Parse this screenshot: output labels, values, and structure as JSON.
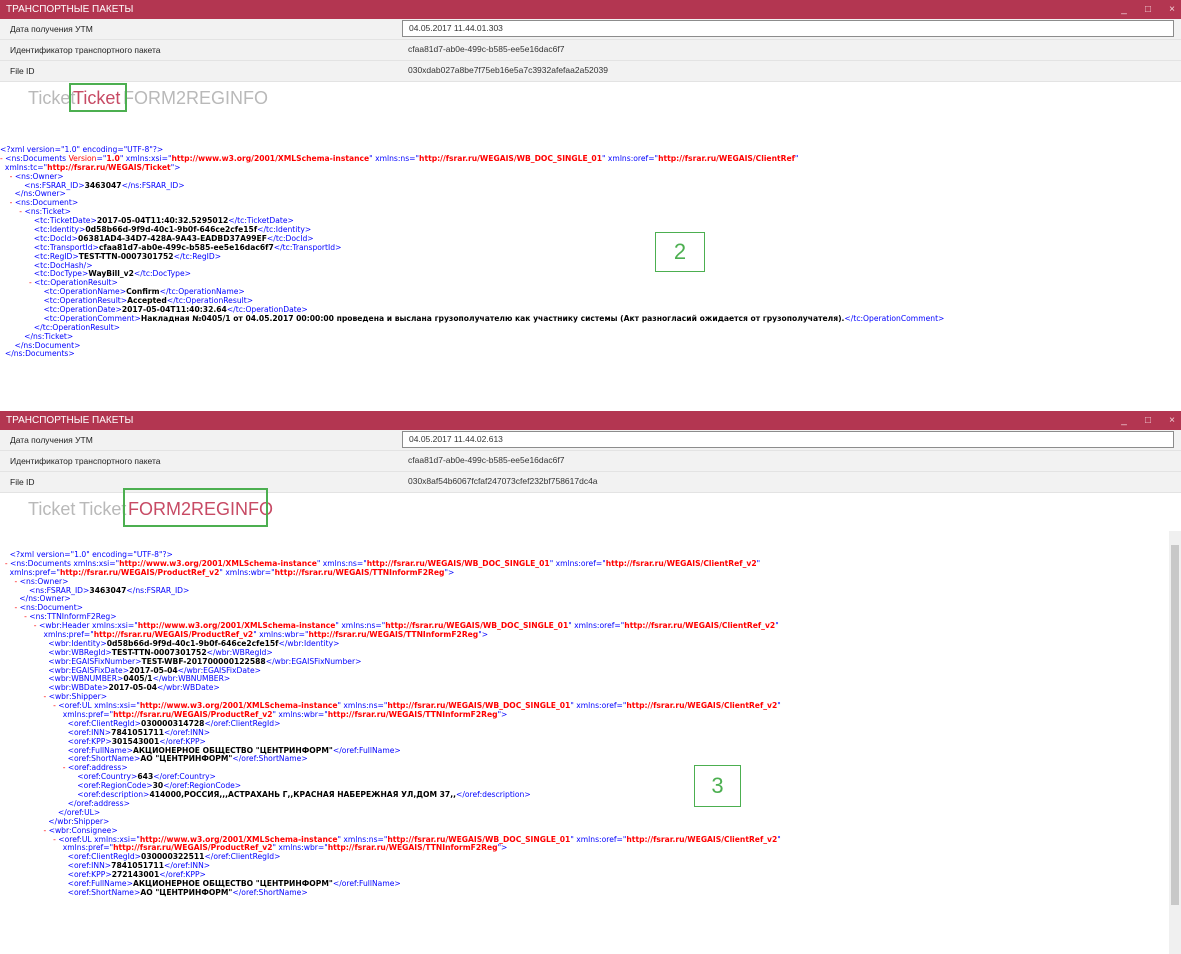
{
  "win1": {
    "title": "ТРАНСПОРТНЫЕ ПАКЕТЫ",
    "controls": [
      "_",
      "□",
      "×"
    ],
    "fields": [
      {
        "label": "Дата получения УТМ",
        "value": "04.05.2017 11.44.01.303"
      },
      {
        "label": "Идентификатор транспортного пакета",
        "value": "cfaa81d7-ab0e-499c-b585-ee5e16dac6f7"
      },
      {
        "label": "File ID",
        "value": "030xdab027a8be7f75eb16e5a7c3932afefaa2a52039"
      }
    ],
    "tabs": [
      "Ticket",
      "Ticket",
      "FORM2REGINFO"
    ],
    "annotation": "2",
    "xml": [
      [
        [
          "t",
          "<?xml version=\"1.0\" encoding=\"UTF-8\"?>"
        ]
      ],
      [
        [
          "mk",
          "- "
        ],
        [
          "t",
          "<ns:Documents "
        ],
        [
          "an",
          "Version"
        ],
        [
          "t",
          "=\""
        ],
        [
          "av",
          "1.0"
        ],
        [
          "t",
          "\" xmlns:xsi=\""
        ],
        [
          "av",
          "http://www.w3.org/2001/XMLSchema-instance"
        ],
        [
          "t",
          "\" xmlns:ns=\""
        ],
        [
          "av",
          "http://fsrar.ru/WEGAIS/WB_DOC_SINGLE_01"
        ],
        [
          "t",
          "\" xmlns:oref=\""
        ],
        [
          "av",
          "http://fsrar.ru/WEGAIS/ClientRef"
        ],
        [
          "t",
          "\""
        ]
      ],
      [
        [
          "t",
          "  xmlns:tc=\""
        ],
        [
          "av",
          "http://fsrar.ru/WEGAIS/Ticket"
        ],
        [
          "t",
          "\">"
        ]
      ],
      [
        [
          "mk",
          "    - "
        ],
        [
          "t",
          "<ns:Owner>"
        ]
      ],
      [
        [
          "t",
          "          <ns:FSRAR_ID>"
        ],
        [
          "tx",
          "3463047"
        ],
        [
          "t",
          "</ns:FSRAR_ID>"
        ]
      ],
      [
        [
          "t",
          "      </ns:Owner>"
        ]
      ],
      [
        [
          "mk",
          "    - "
        ],
        [
          "t",
          "<ns:Document>"
        ]
      ],
      [
        [
          "mk",
          "        - "
        ],
        [
          "t",
          "<ns:Ticket>"
        ]
      ],
      [
        [
          "t",
          "              <tc:TicketDate>"
        ],
        [
          "tx",
          "2017-05-04T11:40:32.5295012"
        ],
        [
          "t",
          "</tc:TicketDate>"
        ]
      ],
      [
        [
          "t",
          "              <tc:Identity>"
        ],
        [
          "tx",
          "0d58b66d-9f9d-40c1-9b0f-646ce2cfe15f"
        ],
        [
          "t",
          "</tc:Identity>"
        ]
      ],
      [
        [
          "t",
          "              <tc:DocId>"
        ],
        [
          "tx",
          "06381AD4-34D7-428A-9A43-EADBD37A99EF"
        ],
        [
          "t",
          "</tc:DocId>"
        ]
      ],
      [
        [
          "t",
          "              <tc:TransportId>"
        ],
        [
          "tx",
          "cfaa81d7-ab0e-499c-b585-ee5e16dac6f7"
        ],
        [
          "t",
          "</tc:TransportId>"
        ]
      ],
      [
        [
          "t",
          "              <tc:RegID>"
        ],
        [
          "tx",
          "TEST-TTN-0007301752"
        ],
        [
          "t",
          "</tc:RegID>"
        ]
      ],
      [
        [
          "t",
          "              <tc:DocHash/>"
        ]
      ],
      [
        [
          "t",
          "              <tc:DocType>"
        ],
        [
          "tx",
          "WayBill_v2"
        ],
        [
          "t",
          "</tc:DocType>"
        ]
      ],
      [
        [
          "mk",
          "            - "
        ],
        [
          "t",
          "<tc:OperationResult>"
        ]
      ],
      [
        [
          "t",
          "                  <tc:OperationName>"
        ],
        [
          "tx",
          "Confirm"
        ],
        [
          "t",
          "</tc:OperationName>"
        ]
      ],
      [
        [
          "t",
          "                  <tc:OperationResult>"
        ],
        [
          "tx",
          "Accepted"
        ],
        [
          "t",
          "</tc:OperationResult>"
        ]
      ],
      [
        [
          "t",
          "                  <tc:OperationDate>"
        ],
        [
          "tx",
          "2017-05-04T11:40:32.64"
        ],
        [
          "t",
          "</tc:OperationDate>"
        ]
      ],
      [
        [
          "t",
          "                  <tc:OperationComment>"
        ],
        [
          "tx",
          "Накладная №0405/1 от 04.05.2017 00:00:00 проведена и выслана грузополучателю как участнику системы (Акт разногласий ожидается от грузополучателя)."
        ],
        [
          "t",
          "</tc:OperationComment>"
        ]
      ],
      [
        [
          "t",
          "              </tc:OperationResult>"
        ]
      ],
      [
        [
          "t",
          "          </ns:Ticket>"
        ]
      ],
      [
        [
          "t",
          "      </ns:Document>"
        ]
      ],
      [
        [
          "t",
          "  </ns:Documents>"
        ]
      ]
    ]
  },
  "win2": {
    "title": "ТРАНСПОРТНЫЕ ПАКЕТЫ",
    "controls": [
      "_",
      "□",
      "×"
    ],
    "fields": [
      {
        "label": "Дата получения УТМ",
        "value": "04.05.2017 11.44.02.613"
      },
      {
        "label": "Идентификатор транспортного пакета",
        "value": "cfaa81d7-ab0e-499c-b585-ee5e16dac6f7"
      },
      {
        "label": "File ID",
        "value": "030x8af54b6067fcfaf247073cfef232bf758617dc4a"
      }
    ],
    "tabs": [
      "Ticket",
      "Ticket",
      "FORM2REGINFO"
    ],
    "annotation": "3",
    "xml": [
      [
        [
          "t",
          "    <?xml version=\"1.0\" encoding=\"UTF-8\"?>"
        ]
      ],
      [
        [
          "mk",
          "  - "
        ],
        [
          "t",
          "<ns:Documents xmlns:xsi=\""
        ],
        [
          "av",
          "http://www.w3.org/2001/XMLSchema-instance"
        ],
        [
          "t",
          "\" xmlns:ns=\""
        ],
        [
          "av",
          "http://fsrar.ru/WEGAIS/WB_DOC_SINGLE_01"
        ],
        [
          "t",
          "\" xmlns:oref=\""
        ],
        [
          "av",
          "http://fsrar.ru/WEGAIS/ClientRef_v2"
        ],
        [
          "t",
          "\""
        ]
      ],
      [
        [
          "t",
          "    xmlns:pref=\""
        ],
        [
          "av",
          "http://fsrar.ru/WEGAIS/ProductRef_v2"
        ],
        [
          "t",
          "\" xmlns:wbr=\""
        ],
        [
          "av",
          "http://fsrar.ru/WEGAIS/TTNInformF2Reg"
        ],
        [
          "t",
          "\">"
        ]
      ],
      [
        [
          "mk",
          "      - "
        ],
        [
          "t",
          "<ns:Owner>"
        ]
      ],
      [
        [
          "t",
          "            <ns:FSRAR_ID>"
        ],
        [
          "tx",
          "3463047"
        ],
        [
          "t",
          "</ns:FSRAR_ID>"
        ]
      ],
      [
        [
          "t",
          "        </ns:Owner>"
        ]
      ],
      [
        [
          "mk",
          "      - "
        ],
        [
          "t",
          "<ns:Document>"
        ]
      ],
      [
        [
          "mk",
          "          - "
        ],
        [
          "t",
          "<ns:TTNInformF2Reg>"
        ]
      ],
      [
        [
          "mk",
          "              - "
        ],
        [
          "t",
          "<wbr:Header xmlns:xsi=\""
        ],
        [
          "av",
          "http://www.w3.org/2001/XMLSchema-instance"
        ],
        [
          "t",
          "\" xmlns:ns=\""
        ],
        [
          "av",
          "http://fsrar.ru/WEGAIS/WB_DOC_SINGLE_01"
        ],
        [
          "t",
          "\" xmlns:oref=\""
        ],
        [
          "av",
          "http://fsrar.ru/WEGAIS/ClientRef_v2"
        ],
        [
          "t",
          "\""
        ]
      ],
      [
        [
          "t",
          "                  xmlns:pref=\""
        ],
        [
          "av",
          "http://fsrar.ru/WEGAIS/ProductRef_v2"
        ],
        [
          "t",
          "\" xmlns:wbr=\""
        ],
        [
          "av",
          "http://fsrar.ru/WEGAIS/TTNInformF2Reg"
        ],
        [
          "t",
          "\">"
        ]
      ],
      [
        [
          "t",
          "                    <wbr:Identity>"
        ],
        [
          "tx",
          "0d58b66d-9f9d-40c1-9b0f-646ce2cfe15f"
        ],
        [
          "t",
          "</wbr:Identity>"
        ]
      ],
      [
        [
          "t",
          "                    <wbr:WBRegId>"
        ],
        [
          "tx",
          "TEST-TTN-0007301752"
        ],
        [
          "t",
          "</wbr:WBRegId>"
        ]
      ],
      [
        [
          "t",
          "                    <wbr:EGAISFixNumber>"
        ],
        [
          "tx",
          "TEST-WBF-201700000122588"
        ],
        [
          "t",
          "</wbr:EGAISFixNumber>"
        ]
      ],
      [
        [
          "t",
          "                    <wbr:EGAISFixDate>"
        ],
        [
          "tx",
          "2017-05-04"
        ],
        [
          "t",
          "</wbr:EGAISFixDate>"
        ]
      ],
      [
        [
          "t",
          "                    <wbr:WBNUMBER>"
        ],
        [
          "tx",
          "0405/1"
        ],
        [
          "t",
          "</wbr:WBNUMBER>"
        ]
      ],
      [
        [
          "t",
          "                    <wbr:WBDate>"
        ],
        [
          "tx",
          "2017-05-04"
        ],
        [
          "t",
          "</wbr:WBDate>"
        ]
      ],
      [
        [
          "mk",
          "                  - "
        ],
        [
          "t",
          "<wbr:Shipper>"
        ]
      ],
      [
        [
          "mk",
          "                      - "
        ],
        [
          "t",
          "<oref:UL xmlns:xsi=\""
        ],
        [
          "av",
          "http://www.w3.org/2001/XMLSchema-instance"
        ],
        [
          "t",
          "\" xmlns:ns=\""
        ],
        [
          "av",
          "http://fsrar.ru/WEGAIS/WB_DOC_SINGLE_01"
        ],
        [
          "t",
          "\" xmlns:oref=\""
        ],
        [
          "av",
          "http://fsrar.ru/WEGAIS/ClientRef_v2"
        ],
        [
          "t",
          "\""
        ]
      ],
      [
        [
          "t",
          "                          xmlns:pref=\""
        ],
        [
          "av",
          "http://fsrar.ru/WEGAIS/ProductRef_v2"
        ],
        [
          "t",
          "\" xmlns:wbr=\""
        ],
        [
          "av",
          "http://fsrar.ru/WEGAIS/TTNInformF2Reg"
        ],
        [
          "t",
          "\">"
        ]
      ],
      [
        [
          "t",
          "                            <oref:ClientRegId>"
        ],
        [
          "tx",
          "030000314728"
        ],
        [
          "t",
          "</oref:ClientRegId>"
        ]
      ],
      [
        [
          "t",
          "                            <oref:INN>"
        ],
        [
          "tx",
          "7841051711"
        ],
        [
          "t",
          "</oref:INN>"
        ]
      ],
      [
        [
          "t",
          "                            <oref:KPP>"
        ],
        [
          "tx",
          "301543001"
        ],
        [
          "t",
          "</oref:KPP>"
        ]
      ],
      [
        [
          "t",
          "                            <oref:FullName>"
        ],
        [
          "tx",
          "АКЦИОНЕРНОЕ ОБЩЕСТВО \"ЦЕНТРИНФОРМ\""
        ],
        [
          "t",
          "</oref:FullName>"
        ]
      ],
      [
        [
          "t",
          "                            <oref:ShortName>"
        ],
        [
          "tx",
          "АО \"ЦЕНТРИНФОРМ\""
        ],
        [
          "t",
          "</oref:ShortName>"
        ]
      ],
      [
        [
          "mk",
          "                          - "
        ],
        [
          "t",
          "<oref:address>"
        ]
      ],
      [
        [
          "t",
          "                                <oref:Country>"
        ],
        [
          "tx",
          "643"
        ],
        [
          "t",
          "</oref:Country>"
        ]
      ],
      [
        [
          "t",
          "                                <oref:RegionCode>"
        ],
        [
          "tx",
          "30"
        ],
        [
          "t",
          "</oref:RegionCode>"
        ]
      ],
      [
        [
          "t",
          "                                <oref:description>"
        ],
        [
          "tx",
          "414000,РОССИЯ,,,АСТРАХАНЬ Г,,КРАСНАЯ НАБЕРЕЖНАЯ УЛ,ДОМ 37,,"
        ],
        [
          "t",
          "</oref:description>"
        ]
      ],
      [
        [
          "t",
          "                            </oref:address>"
        ]
      ],
      [
        [
          "t",
          "                        </oref:UL>"
        ]
      ],
      [
        [
          "t",
          "                    </wbr:Shipper>"
        ]
      ],
      [
        [
          "mk",
          "                  - "
        ],
        [
          "t",
          "<wbr:Consignee>"
        ]
      ],
      [
        [
          "mk",
          "                      - "
        ],
        [
          "t",
          "<oref:UL xmlns:xsi=\""
        ],
        [
          "av",
          "http://www.w3.org/2001/XMLSchema-instance"
        ],
        [
          "t",
          "\" xmlns:ns=\""
        ],
        [
          "av",
          "http://fsrar.ru/WEGAIS/WB_DOC_SINGLE_01"
        ],
        [
          "t",
          "\" xmlns:oref=\""
        ],
        [
          "av",
          "http://fsrar.ru/WEGAIS/ClientRef_v2"
        ],
        [
          "t",
          "\""
        ]
      ],
      [
        [
          "t",
          "                          xmlns:pref=\""
        ],
        [
          "av",
          "http://fsrar.ru/WEGAIS/ProductRef_v2"
        ],
        [
          "t",
          "\" xmlns:wbr=\""
        ],
        [
          "av",
          "http://fsrar.ru/WEGAIS/TTNInformF2Reg"
        ],
        [
          "t",
          "\">"
        ]
      ],
      [
        [
          "t",
          "                            <oref:ClientRegId>"
        ],
        [
          "tx",
          "030000322511"
        ],
        [
          "t",
          "</oref:ClientRegId>"
        ]
      ],
      [
        [
          "t",
          "                            <oref:INN>"
        ],
        [
          "tx",
          "7841051711"
        ],
        [
          "t",
          "</oref:INN>"
        ]
      ],
      [
        [
          "t",
          "                            <oref:KPP>"
        ],
        [
          "tx",
          "272143001"
        ],
        [
          "t",
          "</oref:KPP>"
        ]
      ],
      [
        [
          "t",
          "                            <oref:FullName>"
        ],
        [
          "tx",
          "АКЦИОНЕРНОЕ ОБЩЕСТВО \"ЦЕНТРИНФОРМ\""
        ],
        [
          "t",
          "</oref:FullName>"
        ]
      ],
      [
        [
          "t",
          "                            <oref:ShortName>"
        ],
        [
          "tx",
          "АО \"ЦЕНТРИНФОРМ\""
        ],
        [
          "t",
          "</oref:ShortName>"
        ]
      ]
    ]
  }
}
